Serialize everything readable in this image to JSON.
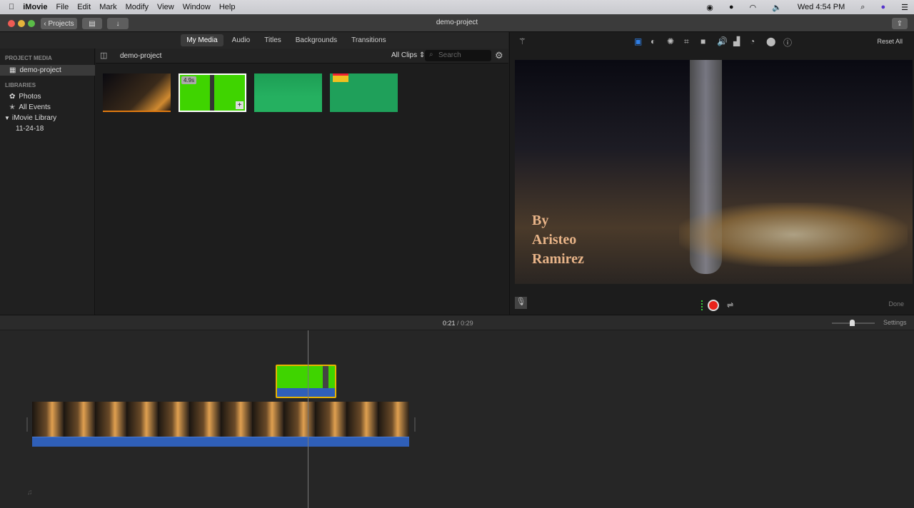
{
  "menubar": {
    "app": "iMovie",
    "items": [
      "File",
      "Edit",
      "Mark",
      "Modify",
      "View",
      "Window",
      "Help"
    ],
    "clock": "Wed 4:54 PM"
  },
  "titlebar": {
    "projects_label": "Projects",
    "title": "demo-project"
  },
  "tabs": [
    "My Media",
    "Audio",
    "Titles",
    "Backgrounds",
    "Transitions"
  ],
  "sidebar": {
    "project_media_header": "PROJECT MEDIA",
    "project": "demo-project",
    "libraries_header": "LIBRARIES",
    "photos": "Photos",
    "all_events": "All Events",
    "library": "iMovie Library",
    "event": "11-24-18"
  },
  "browser": {
    "title": "demo-project",
    "filter": "All Clips",
    "search_placeholder": "Search",
    "clip_duration": "4.9s"
  },
  "viewer": {
    "reset_all": "Reset All",
    "done": "Done",
    "overlay_lines": [
      "By",
      "Aristeo",
      "Ramirez"
    ]
  },
  "timeline": {
    "current": "0:21",
    "separator": "/",
    "total": "0:29",
    "settings": "Settings"
  },
  "colors": {
    "accent": "#2f7fe6",
    "record": "#e8231b",
    "green_screen": "#3fd400",
    "audio": "#2f5fb8"
  }
}
